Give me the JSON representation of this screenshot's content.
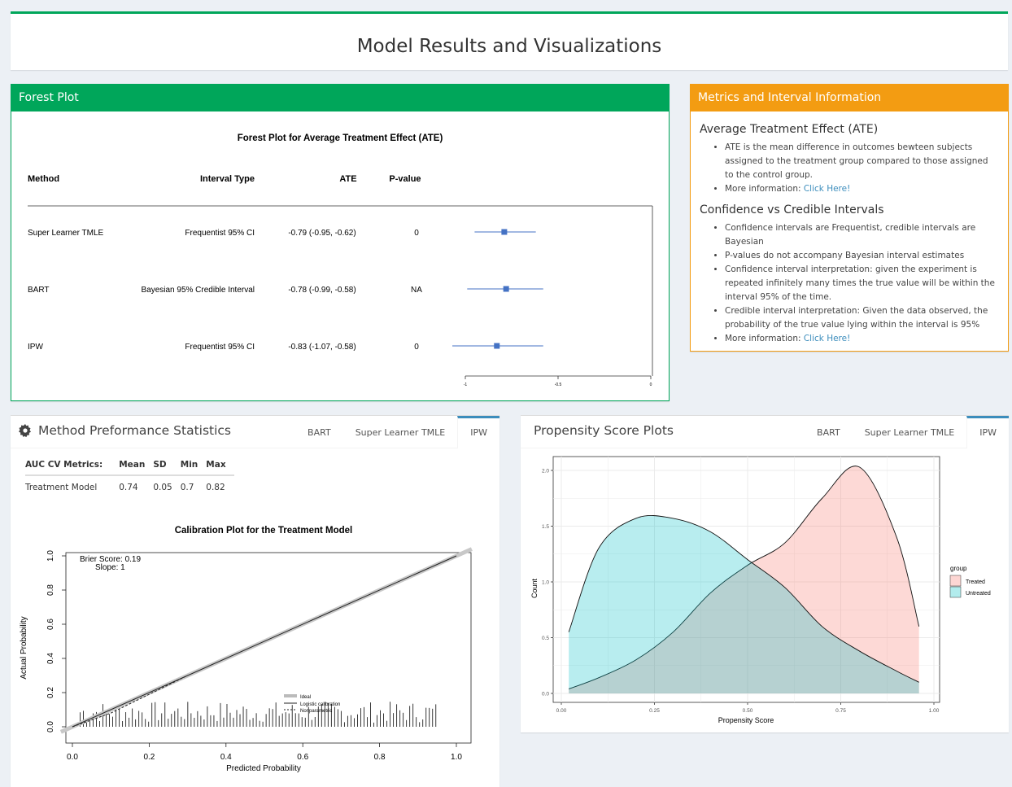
{
  "page": {
    "title": "Model Results and Visualizations"
  },
  "forest": {
    "header": "Forest Plot",
    "chart_title": "Forest Plot for Average Treatment Effect (ATE)",
    "columns": {
      "method": "Method",
      "interval": "Interval Type",
      "ate": "ATE",
      "pvalue": "P-value"
    },
    "rows": [
      {
        "method": "Super Learner TMLE",
        "interval": "Frequentist 95% CI",
        "ate": "-0.79 (-0.95, -0.62)",
        "pvalue": "0"
      },
      {
        "method": "BART",
        "interval": "Bayesian 95% Credible Interval",
        "ate": "-0.78 (-0.99, -0.58)",
        "pvalue": "NA"
      },
      {
        "method": "IPW",
        "interval": "Frequentist 95% CI",
        "ate": "-0.83 (-1.07, -0.58)",
        "pvalue": "0"
      }
    ],
    "axis_ticks": [
      "-1",
      "-0.5",
      "0"
    ]
  },
  "metrics": {
    "header": "Metrics and Interval Information",
    "ate_heading": "Average Treatment Effect (ATE)",
    "ate_text": "ATE is the mean difference in outcomes bewteen subjects assigned to the treatment group compared to those assigned to the control group.",
    "more_info": "More information: ",
    "link_text": "Click Here!",
    "ci_heading": "Confidence vs Credible Intervals",
    "ci_items": [
      "Confidence intervals are Frequentist, credible intervals are Bayesian",
      "P-values do not accompany Bayesian interval estimates",
      "Confidence interval interpretation: given the experiment is repeated infinitely many times the true value will be within the interval 95% of the time.",
      "Credible interval interpretation: Given the data observed, the probability of the true value lying within the interval is 95%"
    ]
  },
  "perf": {
    "title": "Method Preformance Statistics",
    "tabs": [
      "BART",
      "Super Learner TMLE",
      "IPW"
    ],
    "table_headers": [
      "AUC CV Metrics:",
      "Mean",
      "SD",
      "Min",
      "Max"
    ],
    "table_row": [
      "Treatment Model",
      "0.74",
      "0.05",
      "0.7",
      "0.82"
    ],
    "calib_title": "Calibration Plot for the Treatment Model",
    "brier": "Brier Score: 0.19",
    "slope": "Slope: 1",
    "xlabel": "Predicted Probability",
    "ylabel": "Actual Probability",
    "legend": [
      "Ideal",
      "Logistic calibration",
      "Nonparametric"
    ]
  },
  "prop": {
    "title": "Propensity Score Plots",
    "tabs": [
      "BART",
      "Super Learner TMLE",
      "IPW"
    ],
    "xlabel": "Propensity Score",
    "ylabel": "Count",
    "legend_title": "group",
    "legend": [
      "Treated",
      "Untreated"
    ]
  },
  "colors": {
    "green": "#00a65a",
    "orange": "#f39c12",
    "blue": "#3c8dbc",
    "treated": "#f8766d",
    "untreated": "#00bfc4"
  },
  "chart_data": [
    {
      "type": "scatter",
      "title": "Forest Plot for Average Treatment Effect (ATE)",
      "categories": [
        "Super Learner TMLE",
        "BART",
        "IPW"
      ],
      "estimate": [
        -0.79,
        -0.78,
        -0.83
      ],
      "lower": [
        -0.95,
        -0.99,
        -1.07
      ],
      "upper": [
        -0.62,
        -0.58,
        -0.58
      ],
      "xlim": [
        -1.0,
        0.0
      ],
      "xticks": [
        -1,
        -0.5,
        0
      ]
    },
    {
      "type": "line",
      "title": "Calibration Plot for the Treatment Model",
      "xlabel": "Predicted Probability",
      "ylabel": "Actual Probability",
      "xlim": [
        0,
        1
      ],
      "ylim": [
        0,
        1
      ],
      "xticks": [
        0.0,
        0.2,
        0.4,
        0.6,
        0.8,
        1.0
      ],
      "yticks": [
        0.0,
        0.2,
        0.4,
        0.6,
        0.8,
        1.0
      ],
      "series": [
        {
          "name": "Ideal",
          "x": [
            0,
            1
          ],
          "y": [
            0,
            1
          ]
        },
        {
          "name": "Logistic calibration",
          "x": [
            0,
            1
          ],
          "y": [
            0,
            1
          ]
        },
        {
          "name": "Nonparametric",
          "x": [
            0.0,
            0.05,
            0.1,
            0.2,
            0.3
          ],
          "y": [
            0.0,
            0.04,
            0.08,
            0.19,
            0.3
          ]
        }
      ],
      "annotations": [
        "Brier Score: 0.19",
        "Slope: 1"
      ]
    },
    {
      "type": "area",
      "xlabel": "Propensity Score",
      "ylabel": "Count",
      "xlim": [
        0,
        1
      ],
      "ylim": [
        0,
        2
      ],
      "xticks": [
        0.0,
        0.25,
        0.5,
        0.75,
        1.0
      ],
      "yticks": [
        0.0,
        0.5,
        1.0,
        1.5,
        2.0
      ],
      "legend_title": "group",
      "x": [
        0.02,
        0.1,
        0.2,
        0.3,
        0.4,
        0.5,
        0.6,
        0.7,
        0.8,
        0.9,
        0.96
      ],
      "series": [
        {
          "name": "Treated",
          "y": [
            0.04,
            0.14,
            0.3,
            0.55,
            0.9,
            1.15,
            1.35,
            1.75,
            2.03,
            1.4,
            0.6
          ]
        },
        {
          "name": "Untreated",
          "y": [
            0.55,
            1.3,
            1.57,
            1.57,
            1.45,
            1.2,
            0.95,
            0.6,
            0.38,
            0.2,
            0.1
          ]
        }
      ]
    }
  ]
}
